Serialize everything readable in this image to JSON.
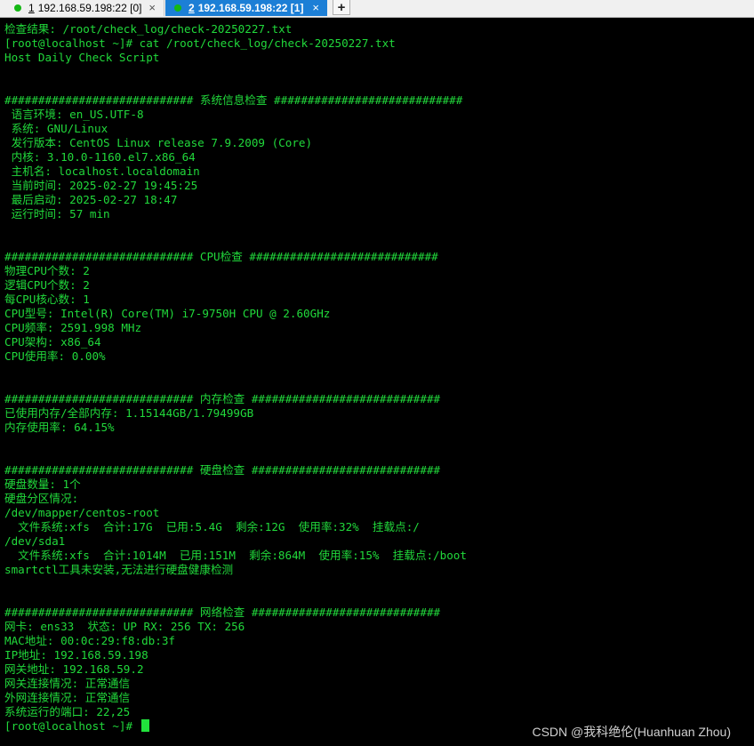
{
  "tabs": [
    {
      "num": "1",
      "label": " 192.168.59.198:22 [0]",
      "close": "×"
    },
    {
      "num": "2",
      "label": " 192.168.59.198:22 [1]",
      "close": "×"
    }
  ],
  "new_tab_label": "+",
  "terminal_lines": [
    "检查结果: /root/check_log/check-20250227.txt",
    "[root@localhost ~]# cat /root/check_log/check-20250227.txt",
    "Host Daily Check Script",
    "",
    "",
    "############################ 系统信息检查 ############################",
    " 语言环境: en_US.UTF-8",
    " 系统: GNU/Linux",
    " 发行版本: CentOS Linux release 7.9.2009 (Core)",
    " 内核: 3.10.0-1160.el7.x86_64",
    " 主机名: localhost.localdomain",
    " 当前时间: 2025-02-27 19:45:25",
    " 最后启动: 2025-02-27 18:47",
    " 运行时间: 57 min",
    "",
    "",
    "############################ CPU检查 ############################",
    "物理CPU个数: 2",
    "逻辑CPU个数: 2",
    "每CPU核心数: 1",
    "CPU型号: Intel(R) Core(TM) i7-9750H CPU @ 2.60GHz",
    "CPU频率: 2591.998 MHz",
    "CPU架构: x86_64",
    "CPU使用率: 0.00%",
    "",
    "",
    "############################ 内存检查 ############################",
    "已使用内存/全部内存: 1.15144GB/1.79499GB",
    "内存使用率: 64.15%",
    "",
    "",
    "############################ 硬盘检查 ############################",
    "硬盘数量: 1个",
    "硬盘分区情况:",
    "/dev/mapper/centos-root",
    "  文件系统:xfs  合计:17G  已用:5.4G  剩余:12G  使用率:32%  挂载点:/",
    "/dev/sda1",
    "  文件系统:xfs  合计:1014M  已用:151M  剩余:864M  使用率:15%  挂载点:/boot",
    "smartctl工具未安装,无法进行硬盘健康检测",
    "",
    "",
    "############################ 网络检查 ############################",
    "网卡: ens33  状态: UP RX: 256 TX: 256",
    "MAC地址: 00:0c:29:f8:db:3f",
    "IP地址: 192.168.59.198",
    "网关地址: 192.168.59.2",
    "网关连接情况: 正常通信",
    "外网连接情况: 正常通信",
    "系统运行的端口: 22,25",
    "[root@localhost ~]# "
  ],
  "watermark": "CSDN @我科绝伦(Huanhuan Zhou)",
  "colors": {
    "text": "#21d93b",
    "background": "#000000",
    "active_tab": "#1c7fd6",
    "status_dot": "#14b814"
  }
}
